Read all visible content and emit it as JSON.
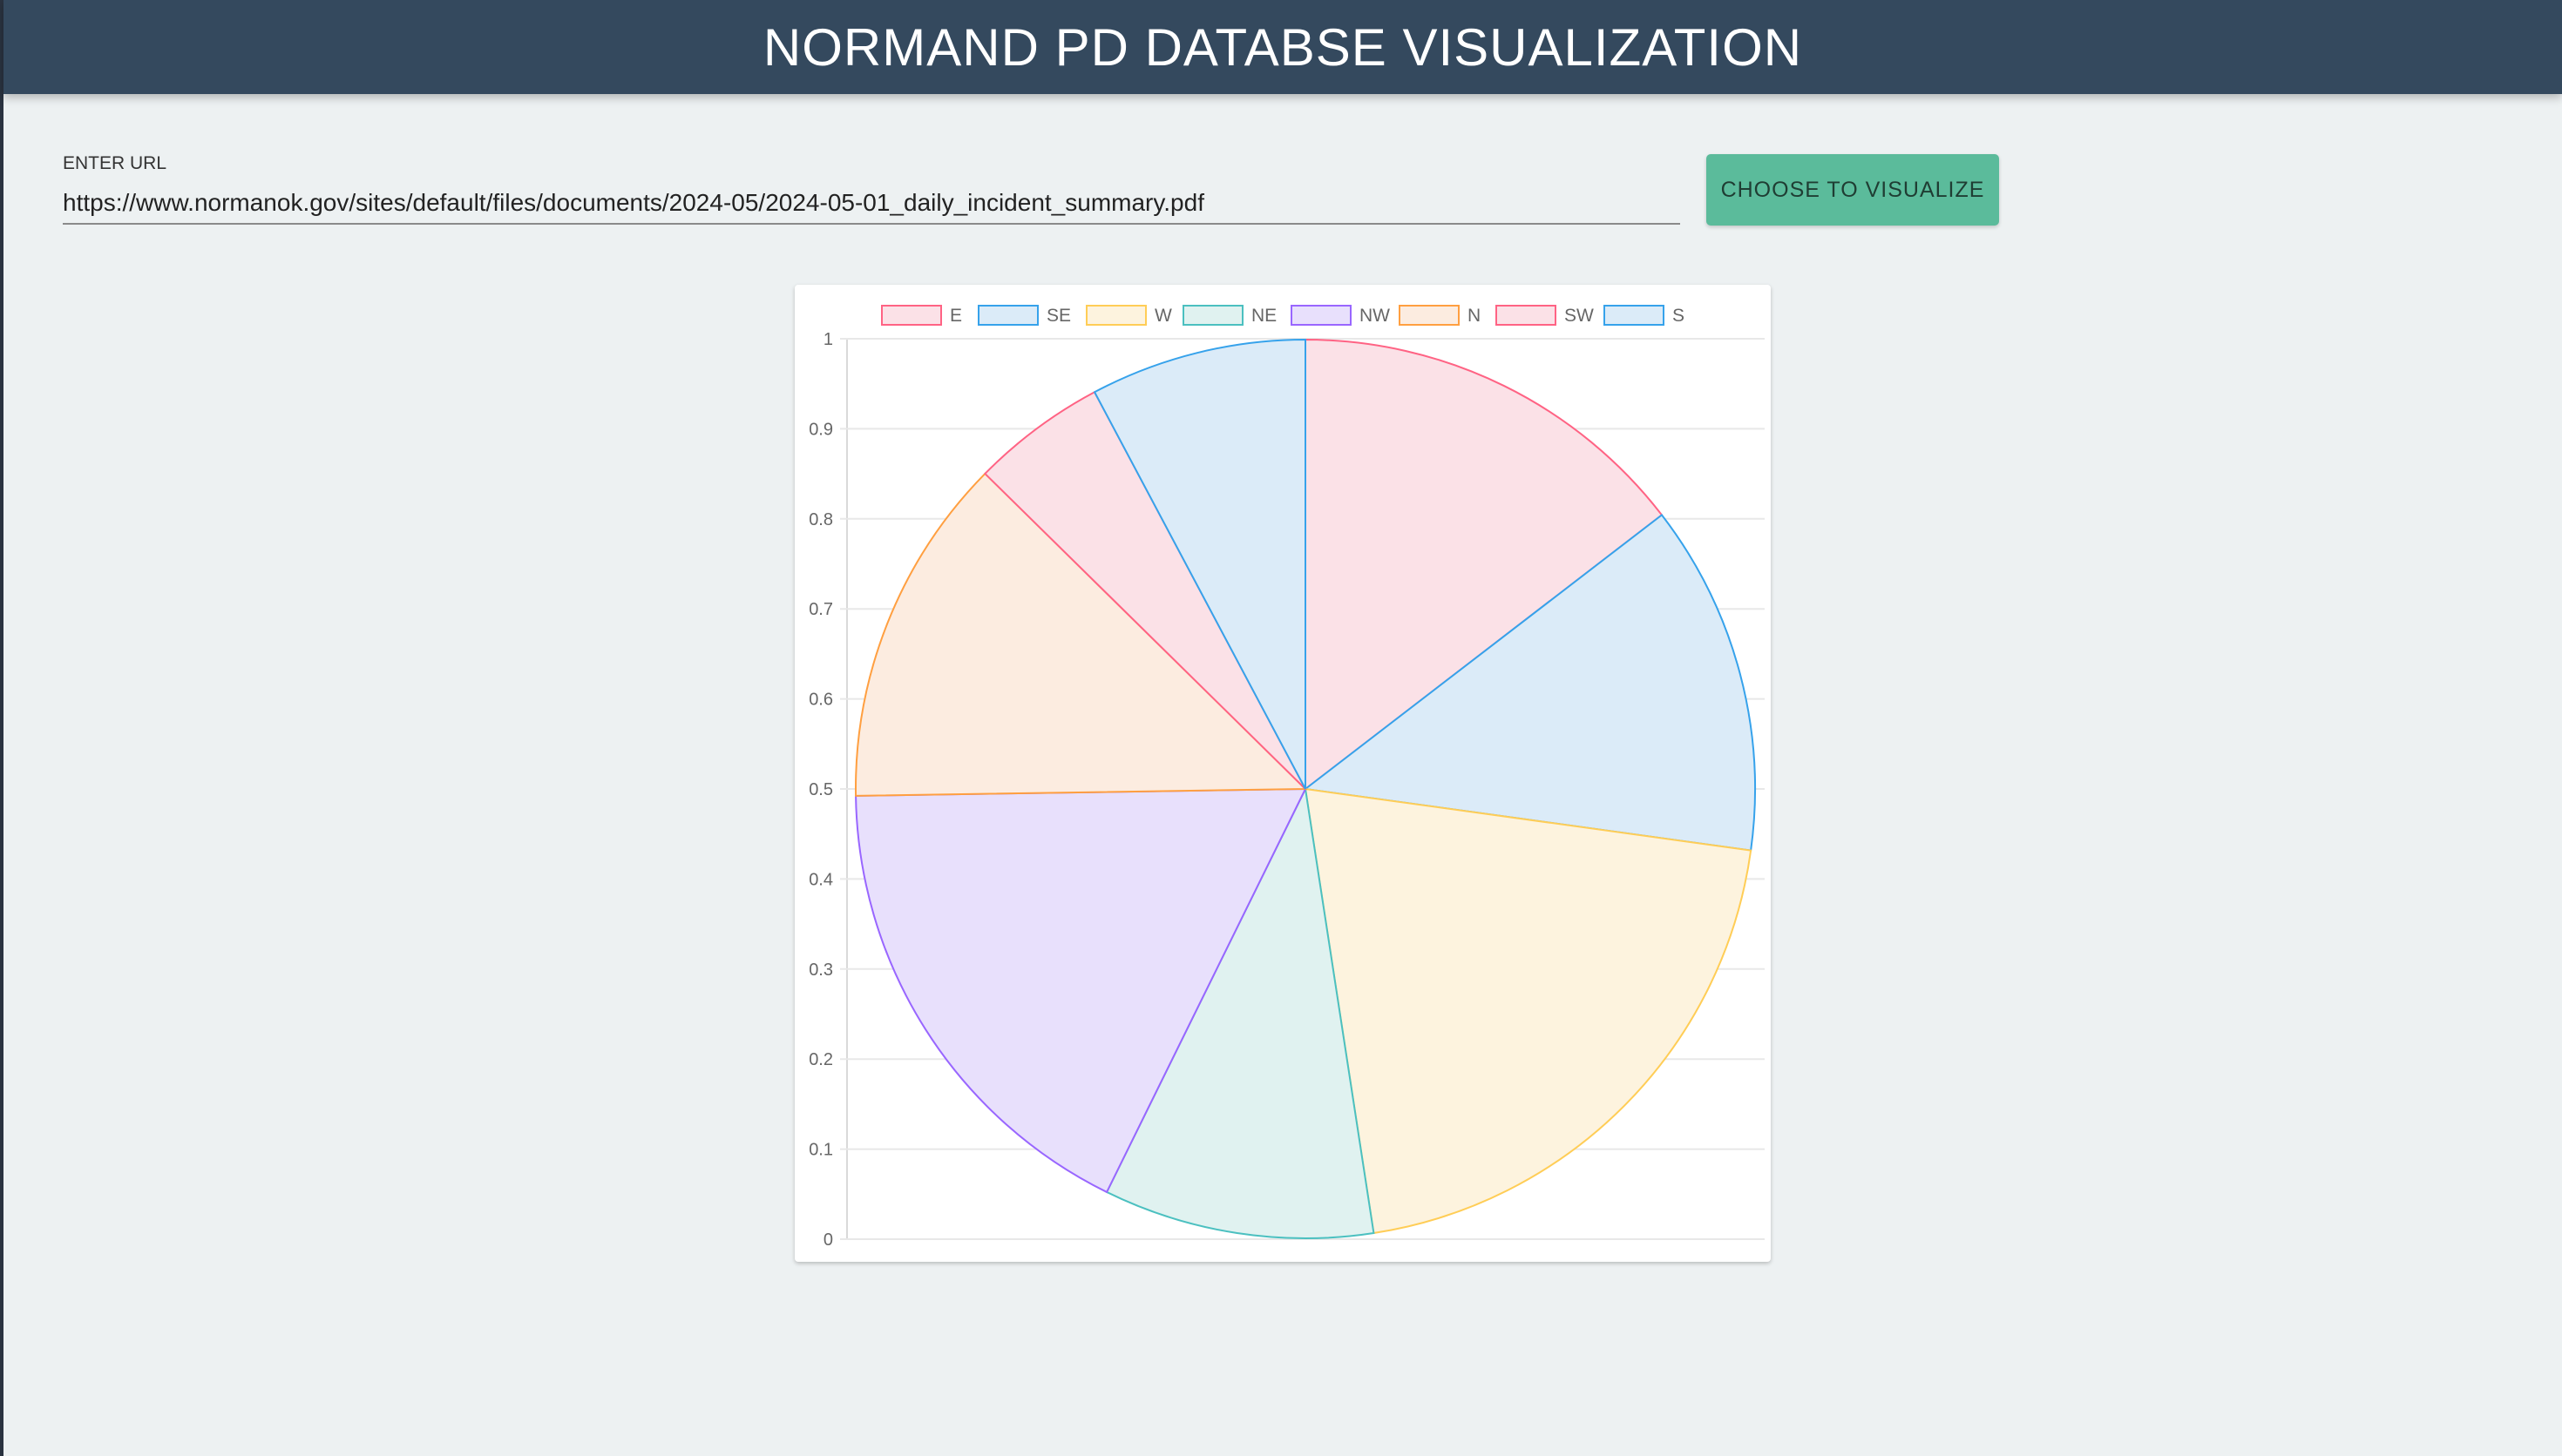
{
  "header": {
    "title": "NORMAND PD DATABSE VISUALIZATION"
  },
  "url_form": {
    "label": "ENTER URL",
    "value": "https://www.normanok.gov/sites/default/files/documents/2024-05/2024-05-01_daily_incident_summary.pdf",
    "button_label": "CHOOSE TO VISUALIZE"
  },
  "colors": {
    "header_bg": "#34495e",
    "button_bg": "#5bbb9b",
    "page_bg": "#edf1f2"
  },
  "chart_data": {
    "type": "pie",
    "labels": [
      "E",
      "SE",
      "W",
      "NE",
      "NW",
      "N",
      "SW",
      "S"
    ],
    "values": [
      15,
      13,
      21,
      10,
      18,
      13,
      5,
      8
    ],
    "legend": "top",
    "grid": true,
    "y_ticks": [
      "0",
      "0.1",
      "0.2",
      "0.3",
      "0.4",
      "0.5",
      "0.6",
      "0.7",
      "0.8",
      "0.9",
      "1"
    ],
    "ylim": [
      0,
      1
    ],
    "colors": [
      {
        "border": "#ff6384",
        "fill": "#fbe1e7"
      },
      {
        "border": "#36a2eb",
        "fill": "#dbebf8"
      },
      {
        "border": "#ffcd56",
        "fill": "#fdf3de"
      },
      {
        "border": "#4bc0c0",
        "fill": "#e0f2f0"
      },
      {
        "border": "#9966ff",
        "fill": "#e8e0fc"
      },
      {
        "border": "#ff9f40",
        "fill": "#fcece0"
      },
      {
        "border": "#ff6384",
        "fill": "#fbe1e7"
      },
      {
        "border": "#36a2eb",
        "fill": "#dbebf8"
      }
    ]
  }
}
